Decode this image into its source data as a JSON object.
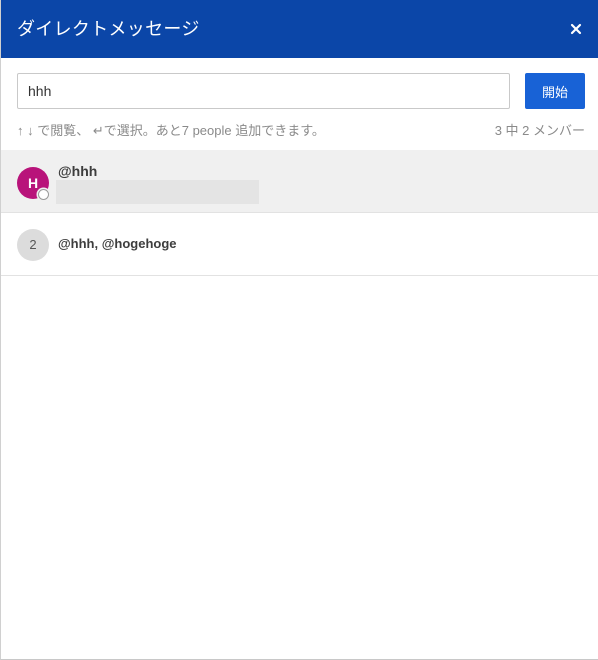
{
  "header": {
    "title": "ダイレクトメッセージ",
    "close_glyph": "×",
    "color": "#0b46a8"
  },
  "search": {
    "value": "hhh",
    "start_label": "開始"
  },
  "hint": {
    "text": "↑ ↓ で閲覧、 ↵で選択。あと7 people 追加できます。",
    "member_count": "3 中 2 メンバー"
  },
  "results": [
    {
      "avatar_text": "H",
      "avatar_color": "#b8137a",
      "name": "@hhh",
      "status": "offline"
    },
    {
      "avatar_text": "2",
      "name": "@hhh, @hogehoge"
    }
  ],
  "accent_color": "#1862d6"
}
